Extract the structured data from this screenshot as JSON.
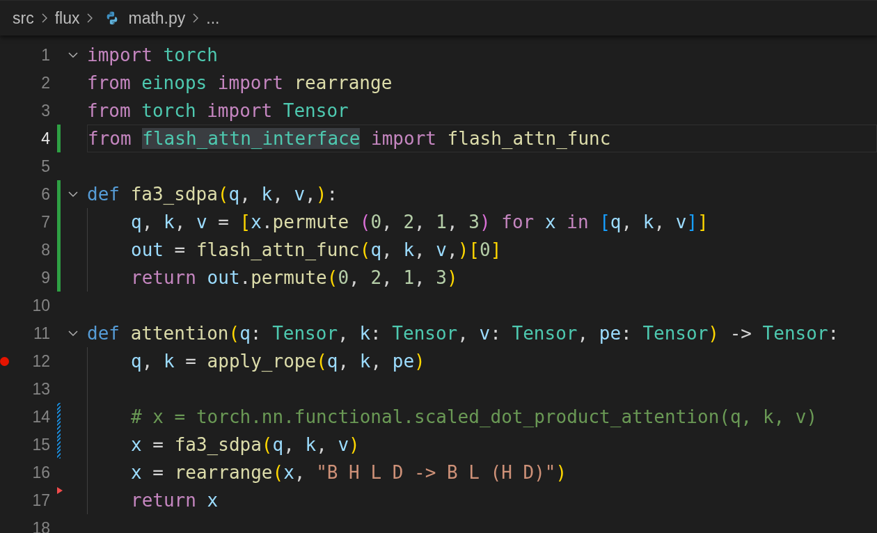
{
  "breadcrumb": [
    {
      "text": "src",
      "kind": "folder"
    },
    {
      "text": "flux",
      "kind": "folder"
    },
    {
      "text": "math.py",
      "kind": "python-file"
    },
    {
      "text": "...",
      "kind": "more"
    }
  ],
  "lines": [
    {
      "number": "1",
      "fold": true,
      "current": false,
      "breakpoint": false,
      "indented": false,
      "tokens": [
        {
          "text": "import ",
          "kind": "kw"
        },
        {
          "text": "torch",
          "kind": "mod"
        }
      ]
    },
    {
      "number": "2",
      "fold": false,
      "current": false,
      "breakpoint": false,
      "indented": false,
      "tokens": [
        {
          "text": "from ",
          "kind": "kw"
        },
        {
          "text": "einops ",
          "kind": "mod"
        },
        {
          "text": "import ",
          "kind": "kw"
        },
        {
          "text": "rearrange",
          "kind": "fn"
        }
      ]
    },
    {
      "number": "3",
      "fold": false,
      "current": false,
      "breakpoint": false,
      "indented": false,
      "tokens": [
        {
          "text": "from ",
          "kind": "kw"
        },
        {
          "text": "torch ",
          "kind": "mod"
        },
        {
          "text": "import ",
          "kind": "kw"
        },
        {
          "text": "Tensor",
          "kind": "mod"
        }
      ]
    },
    {
      "number": "4",
      "fold": false,
      "current": true,
      "breakpoint": false,
      "indented": false,
      "gutter_marker": {
        "kind": "added"
      },
      "tokens": [
        {
          "text": "from ",
          "kind": "kw"
        },
        {
          "text": "flash_attn_interface",
          "kind": "match"
        },
        {
          "text": " import ",
          "kind": "kw"
        },
        {
          "text": "flash_attn_func",
          "kind": "fn"
        }
      ]
    },
    {
      "number": "5",
      "fold": false,
      "current": false,
      "breakpoint": false,
      "indented": false
    },
    {
      "number": "6",
      "fold": true,
      "current": false,
      "breakpoint": false,
      "indented": false,
      "gutter_marker": {
        "kind": "added"
      },
      "tokens": [
        {
          "text": "def ",
          "kind": "def"
        },
        {
          "text": "fa3_sdpa",
          "kind": "fn"
        },
        {
          "text": "(",
          "kind": "b1"
        },
        {
          "text": "q",
          "kind": "var"
        },
        {
          "text": ", ",
          "kind": "p"
        },
        {
          "text": "k",
          "kind": "var"
        },
        {
          "text": ", ",
          "kind": "p"
        },
        {
          "text": "v",
          "kind": "var"
        },
        {
          "text": ",",
          "kind": "p"
        },
        {
          "text": ")",
          "kind": "b1"
        },
        {
          "text": ":",
          "kind": "p"
        }
      ]
    },
    {
      "number": "7",
      "fold": false,
      "current": false,
      "breakpoint": false,
      "indented": true,
      "gutter_marker": {
        "kind": "added"
      },
      "tokens": [
        {
          "text": "q",
          "kind": "var"
        },
        {
          "text": ", ",
          "kind": "p"
        },
        {
          "text": "k",
          "kind": "var"
        },
        {
          "text": ", ",
          "kind": "p"
        },
        {
          "text": "v",
          "kind": "var"
        },
        {
          "text": " = ",
          "kind": "p"
        },
        {
          "text": "[",
          "kind": "b1"
        },
        {
          "text": "x",
          "kind": "var"
        },
        {
          "text": ".",
          "kind": "p"
        },
        {
          "text": "permute ",
          "kind": "fn"
        },
        {
          "text": "(",
          "kind": "b2"
        },
        {
          "text": "0",
          "kind": "num"
        },
        {
          "text": ", ",
          "kind": "p"
        },
        {
          "text": "2",
          "kind": "num"
        },
        {
          "text": ", ",
          "kind": "p"
        },
        {
          "text": "1",
          "kind": "num"
        },
        {
          "text": ", ",
          "kind": "p"
        },
        {
          "text": "3",
          "kind": "num"
        },
        {
          "text": ")",
          "kind": "b2"
        },
        {
          "text": " for ",
          "kind": "kw"
        },
        {
          "text": "x",
          "kind": "var"
        },
        {
          "text": " in ",
          "kind": "kw"
        },
        {
          "text": "[",
          "kind": "b3"
        },
        {
          "text": "q",
          "kind": "var"
        },
        {
          "text": ", ",
          "kind": "p"
        },
        {
          "text": "k",
          "kind": "var"
        },
        {
          "text": ", ",
          "kind": "p"
        },
        {
          "text": "v",
          "kind": "var"
        },
        {
          "text": "]",
          "kind": "b3"
        },
        {
          "text": "]",
          "kind": "b1"
        }
      ]
    },
    {
      "number": "8",
      "fold": false,
      "current": false,
      "breakpoint": false,
      "indented": true,
      "gutter_marker": {
        "kind": "added"
      },
      "tokens": [
        {
          "text": "out",
          "kind": "var"
        },
        {
          "text": " = ",
          "kind": "p"
        },
        {
          "text": "flash_attn_func",
          "kind": "fn"
        },
        {
          "text": "(",
          "kind": "b1"
        },
        {
          "text": "q",
          "kind": "var"
        },
        {
          "text": ", ",
          "kind": "p"
        },
        {
          "text": "k",
          "kind": "var"
        },
        {
          "text": ", ",
          "kind": "p"
        },
        {
          "text": "v",
          "kind": "var"
        },
        {
          "text": ",",
          "kind": "p"
        },
        {
          "text": ")",
          "kind": "b1"
        },
        {
          "text": "[",
          "kind": "b1"
        },
        {
          "text": "0",
          "kind": "num"
        },
        {
          "text": "]",
          "kind": "b1"
        }
      ]
    },
    {
      "number": "9",
      "fold": false,
      "current": false,
      "breakpoint": false,
      "indented": true,
      "gutter_marker": {
        "kind": "added"
      },
      "tokens": [
        {
          "text": "return ",
          "kind": "kw"
        },
        {
          "text": "out",
          "kind": "var"
        },
        {
          "text": ".",
          "kind": "p"
        },
        {
          "text": "permute",
          "kind": "fn"
        },
        {
          "text": "(",
          "kind": "b1"
        },
        {
          "text": "0",
          "kind": "num"
        },
        {
          "text": ", ",
          "kind": "p"
        },
        {
          "text": "2",
          "kind": "num"
        },
        {
          "text": ", ",
          "kind": "p"
        },
        {
          "text": "1",
          "kind": "num"
        },
        {
          "text": ", ",
          "kind": "p"
        },
        {
          "text": "3",
          "kind": "num"
        },
        {
          "text": ")",
          "kind": "b1"
        }
      ]
    },
    {
      "number": "10",
      "fold": false,
      "current": false,
      "breakpoint": false,
      "indented": false
    },
    {
      "number": "11",
      "fold": true,
      "current": false,
      "breakpoint": false,
      "indented": false,
      "tokens": [
        {
          "text": "def ",
          "kind": "def"
        },
        {
          "text": "attention",
          "kind": "fn"
        },
        {
          "text": "(",
          "kind": "b1"
        },
        {
          "text": "q",
          "kind": "var"
        },
        {
          "text": ": ",
          "kind": "p"
        },
        {
          "text": "Tensor",
          "kind": "mod"
        },
        {
          "text": ", ",
          "kind": "p"
        },
        {
          "text": "k",
          "kind": "var"
        },
        {
          "text": ": ",
          "kind": "p"
        },
        {
          "text": "Tensor",
          "kind": "mod"
        },
        {
          "text": ", ",
          "kind": "p"
        },
        {
          "text": "v",
          "kind": "var"
        },
        {
          "text": ": ",
          "kind": "p"
        },
        {
          "text": "Tensor",
          "kind": "mod"
        },
        {
          "text": ", ",
          "kind": "p"
        },
        {
          "text": "pe",
          "kind": "var"
        },
        {
          "text": ": ",
          "kind": "p"
        },
        {
          "text": "Tensor",
          "kind": "mod"
        },
        {
          "text": ")",
          "kind": "b1"
        },
        {
          "text": " -> ",
          "kind": "p"
        },
        {
          "text": "Tensor",
          "kind": "mod"
        },
        {
          "text": ":",
          "kind": "p"
        }
      ]
    },
    {
      "number": "12",
      "fold": false,
      "current": false,
      "breakpoint": true,
      "indented": true,
      "tokens": [
        {
          "text": "q",
          "kind": "var"
        },
        {
          "text": ", ",
          "kind": "p"
        },
        {
          "text": "k",
          "kind": "var"
        },
        {
          "text": " = ",
          "kind": "p"
        },
        {
          "text": "apply_rope",
          "kind": "fn"
        },
        {
          "text": "(",
          "kind": "b1"
        },
        {
          "text": "q",
          "kind": "var"
        },
        {
          "text": ", ",
          "kind": "p"
        },
        {
          "text": "k",
          "kind": "var"
        },
        {
          "text": ", ",
          "kind": "p"
        },
        {
          "text": "pe",
          "kind": "var"
        },
        {
          "text": ")",
          "kind": "b1"
        }
      ]
    },
    {
      "number": "13",
      "fold": false,
      "current": false,
      "breakpoint": false,
      "indented": true
    },
    {
      "number": "14",
      "fold": false,
      "current": false,
      "breakpoint": false,
      "indented": true,
      "gutter_marker": {
        "kind": "modified"
      },
      "tokens": [
        {
          "text": "# x = torch.nn.functional.scaled_dot_product_attention(q, k, v)",
          "kind": "com"
        }
      ]
    },
    {
      "number": "15",
      "fold": false,
      "current": false,
      "breakpoint": false,
      "indented": true,
      "gutter_marker": {
        "kind": "modified"
      },
      "tokens": [
        {
          "text": "x",
          "kind": "var"
        },
        {
          "text": " = ",
          "kind": "p"
        },
        {
          "text": "fa3_sdpa",
          "kind": "fn"
        },
        {
          "text": "(",
          "kind": "b1"
        },
        {
          "text": "q",
          "kind": "var"
        },
        {
          "text": ", ",
          "kind": "p"
        },
        {
          "text": "k",
          "kind": "var"
        },
        {
          "text": ", ",
          "kind": "p"
        },
        {
          "text": "v",
          "kind": "var"
        },
        {
          "text": ")",
          "kind": "b1"
        }
      ]
    },
    {
      "number": "16",
      "fold": false,
      "current": false,
      "breakpoint": false,
      "indented": true,
      "tokens": [
        {
          "text": "x",
          "kind": "var"
        },
        {
          "text": " = ",
          "kind": "p"
        },
        {
          "text": "rearrange",
          "kind": "fn"
        },
        {
          "text": "(",
          "kind": "b1"
        },
        {
          "text": "x",
          "kind": "var"
        },
        {
          "text": ", ",
          "kind": "p"
        },
        {
          "text": "\"B H L D -> B L (H D)\"",
          "kind": "str"
        },
        {
          "text": ")",
          "kind": "b1"
        }
      ]
    },
    {
      "number": "17",
      "fold": false,
      "current": false,
      "breakpoint": false,
      "indented": true,
      "gutter_marker": {
        "kind": "deleted"
      },
      "tokens": [
        {
          "text": "return ",
          "kind": "kw"
        },
        {
          "text": "x",
          "kind": "var"
        }
      ]
    },
    {
      "number": "18",
      "fold": false,
      "current": false,
      "breakpoint": false,
      "indented": false
    }
  ]
}
